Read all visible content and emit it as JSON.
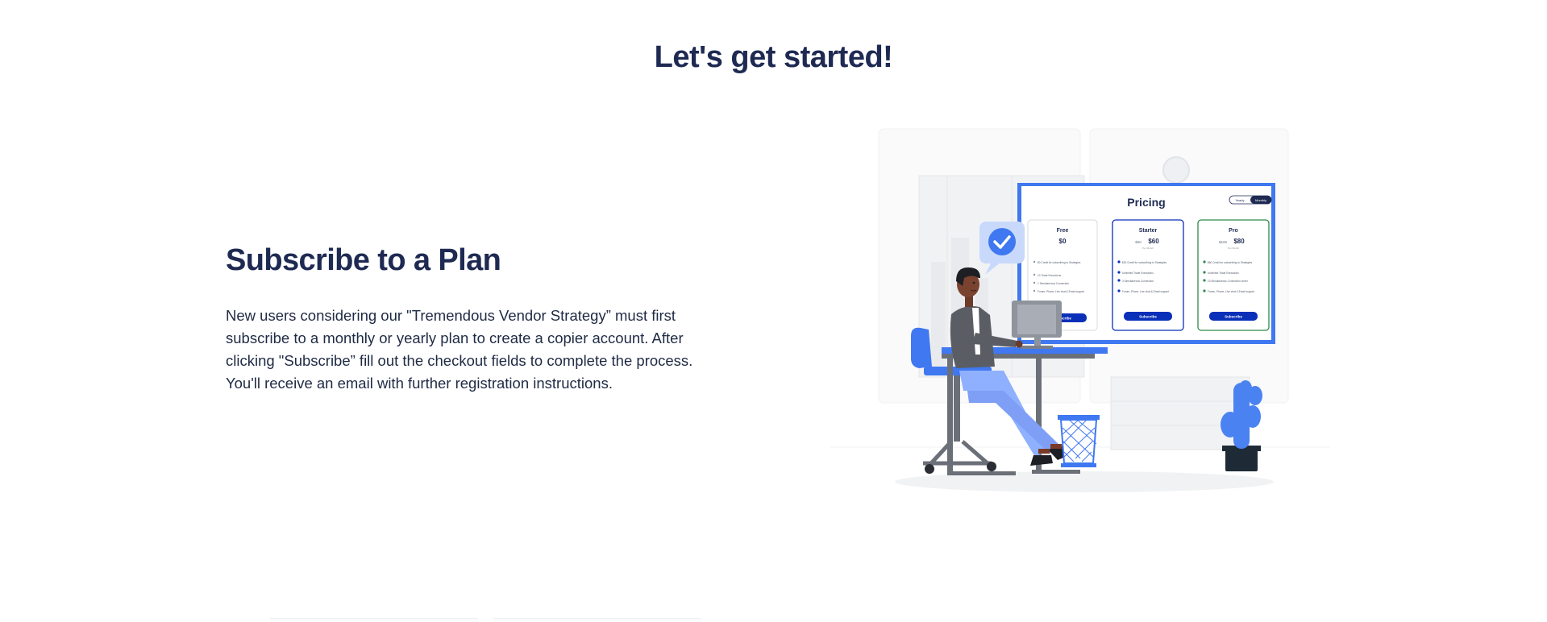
{
  "page": {
    "title": "Let's get started!"
  },
  "section": {
    "heading": "Subscribe to a Plan",
    "body": "New users considering our \"Tremendous Vendor Strategy” must first subscribe to a monthly or yearly plan to create a copier account. After clicking \"Subscribe” fill out the checkout fields to complete the process. You'll receive an email with further registration instructions."
  },
  "illustration": {
    "pricing_title": "Pricing",
    "toggle": [
      "Yearly",
      "Monthly"
    ],
    "plans": [
      {
        "name": "Free",
        "price": "$0",
        "old_price": "",
        "period": "",
        "button": "Subscribe",
        "features": [
          "$0 Credit for subscribing to Strategies",
          "10 Trade Executions",
          "1 Simultaneous Connection",
          "Forum, Phone, Live chat & Email support"
        ]
      },
      {
        "name": "Starter",
        "price": "$60",
        "old_price": "$80",
        "period": "Per Month",
        "button": "Subscribe",
        "features": [
          "$30 Credit for subscribing to Strategies",
          "Unlimited Trade Executions",
          "3 Simultaneous Connection",
          "Forum, Phone, Live chat & Email support"
        ]
      },
      {
        "name": "Pro",
        "price": "$80",
        "old_price": "$100",
        "period": "Per Month",
        "button": "Subscribe",
        "features": [
          "$60 Credit for subscribing to Strategies",
          "Unlimited Trade Executions",
          "10 Simultaneous Connection under",
          "Forum, Phone, Live chat & Email support"
        ]
      }
    ]
  },
  "colors": {
    "heading": "#1e2a52",
    "accent_blue": "#3f78f0",
    "button_blue": "#0a2fb8",
    "pro_green": "#2f8a4a"
  }
}
